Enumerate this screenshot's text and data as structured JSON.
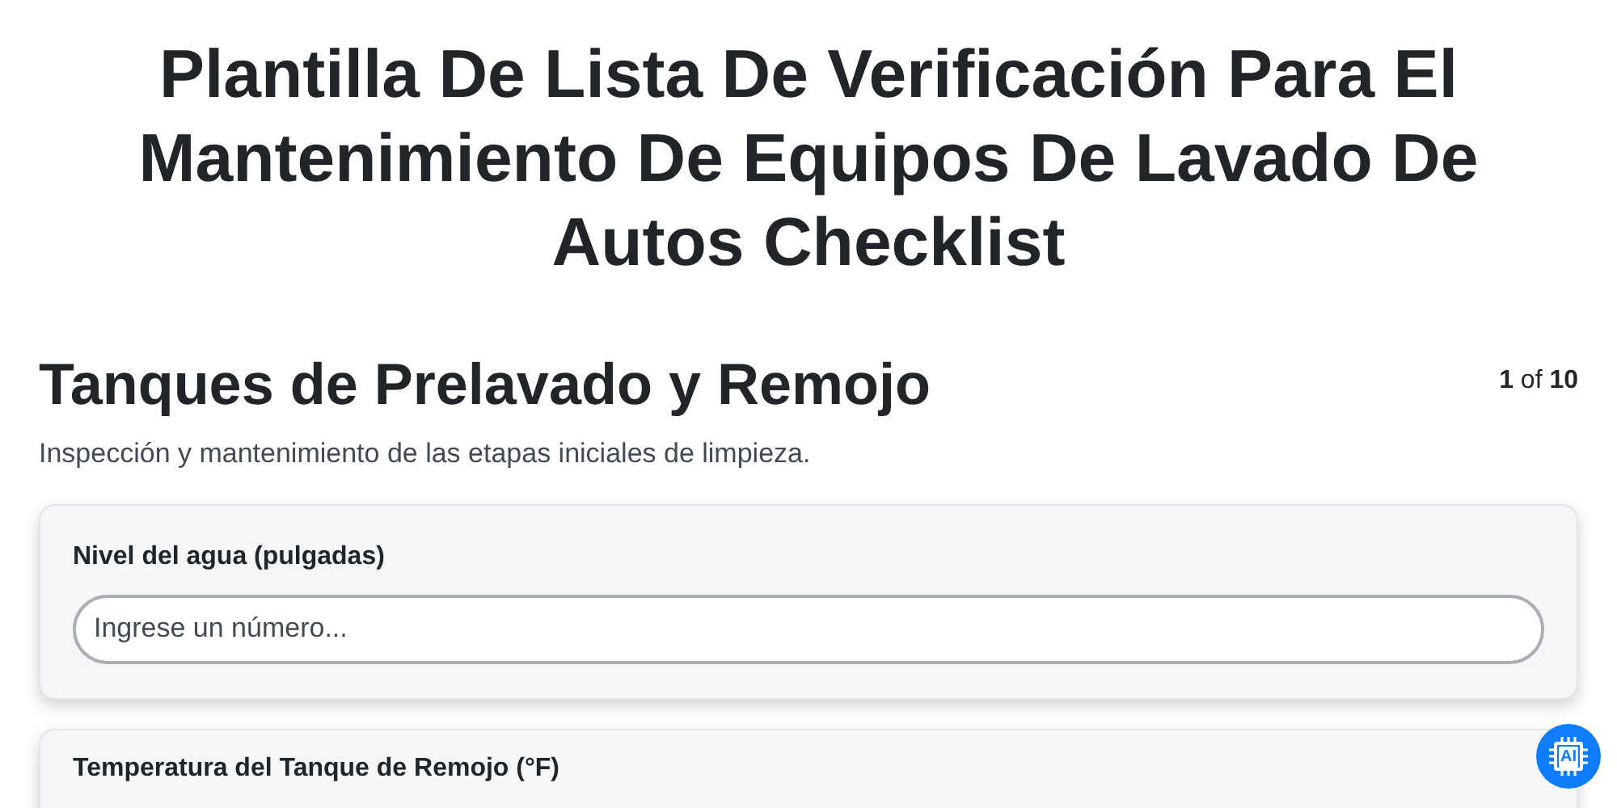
{
  "title": "Plantilla De Lista De Verificación Para El Mantenimiento De Equipos De Lavado De Autos Checklist",
  "section": {
    "heading": "Tanques de Prelavado y Remojo",
    "page_current": "1",
    "page_of": "of",
    "page_total": "10",
    "description": "Inspección y mantenimiento de las etapas iniciales de limpieza."
  },
  "fields": [
    {
      "label": "Nivel del agua (pulgadas)",
      "placeholder": "Ingrese un número..."
    },
    {
      "label": "Temperatura del Tanque de Remojo (°F)"
    }
  ],
  "ai_button": {
    "label": "AI"
  }
}
